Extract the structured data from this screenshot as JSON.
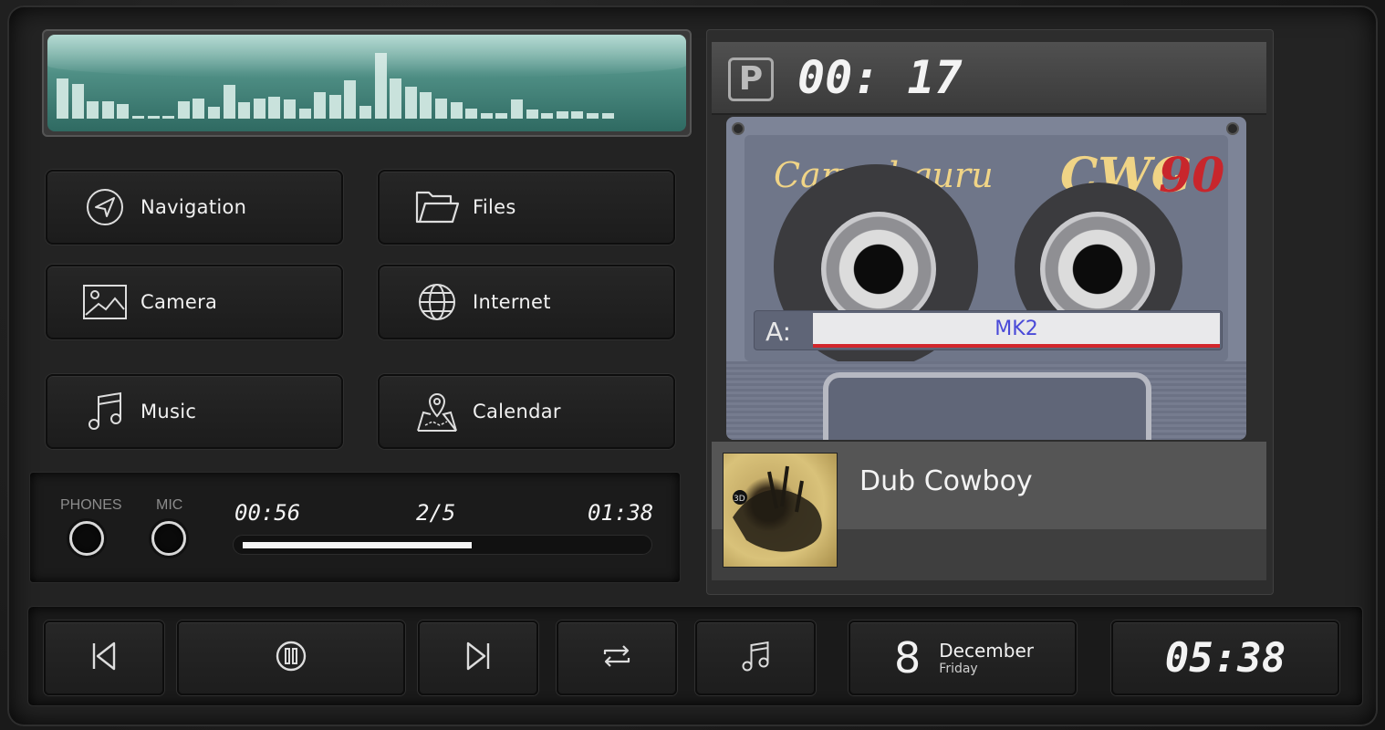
{
  "equalizer": {
    "levels": [
      0.55,
      0.48,
      0.24,
      0.24,
      0.2,
      0.04,
      0.04,
      0.04,
      0.24,
      0.28,
      0.16,
      0.46,
      0.22,
      0.28,
      0.3,
      0.26,
      0.14,
      0.36,
      0.32,
      0.52,
      0.18,
      0.9,
      0.55,
      0.44,
      0.36,
      0.28,
      0.22,
      0.14,
      0.08,
      0.08,
      0.26,
      0.12,
      0.08,
      0.1,
      0.1,
      0.08,
      0.08
    ],
    "color": "#c9e2dc"
  },
  "apps": [
    {
      "label": "Navigation",
      "icon": "navigation-arrow-icon"
    },
    {
      "label": "Files",
      "icon": "folder-icon"
    },
    {
      "label": "Camera",
      "icon": "image-icon"
    },
    {
      "label": "Internet",
      "icon": "globe-icon"
    },
    {
      "label": "Music",
      "icon": "music-note-icon"
    },
    {
      "label": "Calendar",
      "icon": "map-pin-icon"
    }
  ],
  "jacks": {
    "phones_label": "PHONES",
    "mic_label": "MIC"
  },
  "playback": {
    "elapsed": "00:56",
    "track_index": "2/5",
    "duration": "01:38",
    "progress": 0.57
  },
  "status_display": {
    "mode_letter": "P",
    "timer": "00: 17"
  },
  "cassette": {
    "brand": "Carwebguru",
    "model_prefix": "CWG",
    "model_number": "90",
    "side": "A:",
    "tape_title": "MK2"
  },
  "now_playing": {
    "title": "Dub Cowboy",
    "album_badge": "3D"
  },
  "controls": {
    "prev": "skip-previous-icon",
    "pause": "pause-circle-icon",
    "next": "skip-next-icon",
    "repeat": "repeat-icon",
    "music": "music-note-icon"
  },
  "date": {
    "day": "8",
    "month": "December",
    "weekday": "Friday"
  },
  "clock": {
    "time": "05:38"
  },
  "colors": {
    "accent_red": "#d2262c",
    "tape_text": "#4a4ad8",
    "brand_gold": "#f0d486",
    "model_red": "#c8262c"
  }
}
